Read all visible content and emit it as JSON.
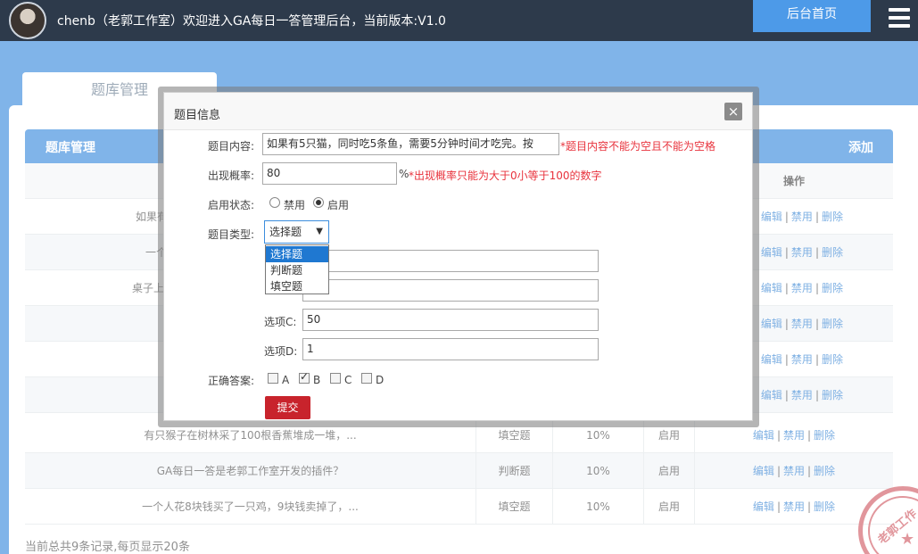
{
  "header": {
    "title": "chenb（老郭工作室）欢迎进入GA每日一答管理后台，当前版本:V1.0",
    "home_button": "后台首页"
  },
  "tab": {
    "label": "题库管理"
  },
  "card": {
    "title": "题库管理",
    "add_label": "添加"
  },
  "table": {
    "ops_header": "操作",
    "edit_label": "编辑",
    "disable_label": "禁用",
    "delete_label": "删除",
    "separator": "|",
    "visible_title_fragments": [
      "如果有",
      "一个",
      "桌子上",
      "",
      "",
      ""
    ],
    "rows": [
      {
        "title": "有只猴子在树林采了100根香蕉堆成一堆，...",
        "type": "填空题",
        "rate": "10%",
        "status": "启用"
      },
      {
        "title": "GA每日一答是老郭工作室开发的插件？",
        "type": "判断题",
        "rate": "10%",
        "status": "启用"
      },
      {
        "title": "一个人花8块钱买了一只鸡，9块钱卖掉了，...",
        "type": "填空题",
        "rate": "10%",
        "status": "启用"
      }
    ],
    "footer": "当前总共9条记录,每页显示20条"
  },
  "stamp": {
    "text": "老郭工作"
  },
  "dialog": {
    "title": "题目信息",
    "close_symbol": "×",
    "content_label": "题目内容:",
    "content_value": "如果有5只猫，同时吃5条鱼，需要5分钟时间才吃完。按",
    "content_error": "*题目内容不能为空且不能为空格",
    "rate_label": "出现概率:",
    "rate_value": "80",
    "rate_unit": "%",
    "rate_error": "*出现概率只能为大于0小等于100的数字",
    "status_label": "启用状态:",
    "status_options": [
      "禁用",
      "启用"
    ],
    "status_selected": "启用",
    "type_label": "题目类型:",
    "type_selected": "选择题",
    "type_options": [
      "选择题",
      "判断题",
      "填空题"
    ],
    "option_c_label": "选项C:",
    "option_c_value": "50",
    "option_d_label": "选项D:",
    "option_d_value": "1",
    "answer_label": "正确答案:",
    "answers": [
      {
        "label": "A",
        "checked": false
      },
      {
        "label": "B",
        "checked": true
      },
      {
        "label": "C",
        "checked": false
      },
      {
        "label": "D",
        "checked": false
      }
    ],
    "submit_label": "提交"
  },
  "colors": {
    "topbar": "#2d3a4b",
    "page_blue": "#3c8ddd",
    "link_blue": "#3a86d4",
    "error_red": "#e8323c",
    "submit_red": "#c8232c"
  }
}
